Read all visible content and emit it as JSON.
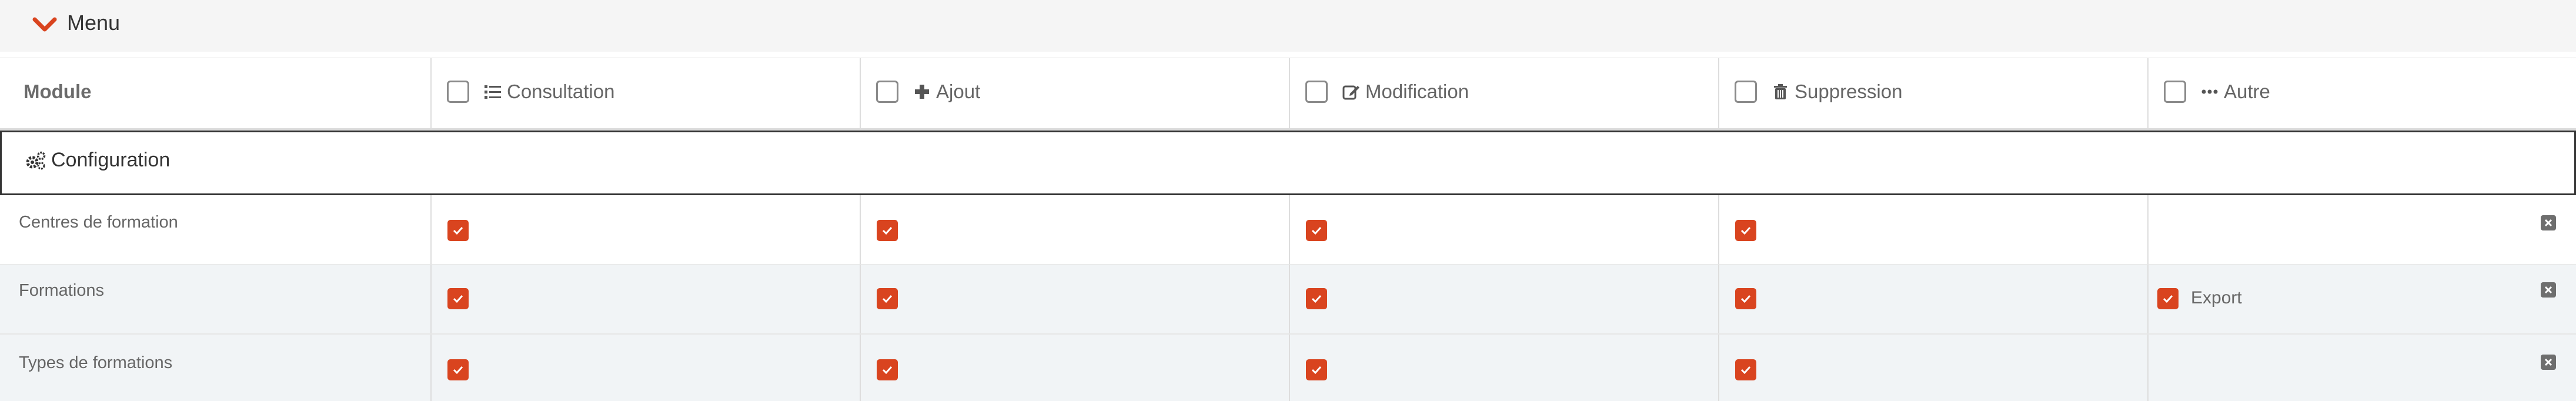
{
  "menu": {
    "title": "Menu",
    "toggle_icon": "chevron-down-icon"
  },
  "colors": {
    "accent": "#d9441f",
    "header_bg": "#f5f5f5",
    "row_alt_bg": "#f1f4f6"
  },
  "table": {
    "module_header": "Module",
    "columns": [
      {
        "label": "Consultation",
        "icon": "list-icon"
      },
      {
        "label": "Ajout",
        "icon": "plus-icon"
      },
      {
        "label": "Modification",
        "icon": "edit-icon"
      },
      {
        "label": "Suppression",
        "icon": "trash-icon"
      },
      {
        "label": "Autre",
        "icon": "ellipsis-icon"
      }
    ],
    "section": {
      "label": "Configuration",
      "icon": "cogs-icon"
    },
    "rows": [
      {
        "label": "Centres de formation",
        "consultation": true,
        "ajout": true,
        "modification": true,
        "suppression": true,
        "autre": []
      },
      {
        "label": "Formations",
        "consultation": true,
        "ajout": true,
        "modification": true,
        "suppression": true,
        "autre": [
          {
            "label": "Export",
            "checked": true
          }
        ]
      },
      {
        "label": "Types de formations",
        "consultation": true,
        "ajout": true,
        "modification": true,
        "suppression": true,
        "autre": []
      }
    ]
  }
}
